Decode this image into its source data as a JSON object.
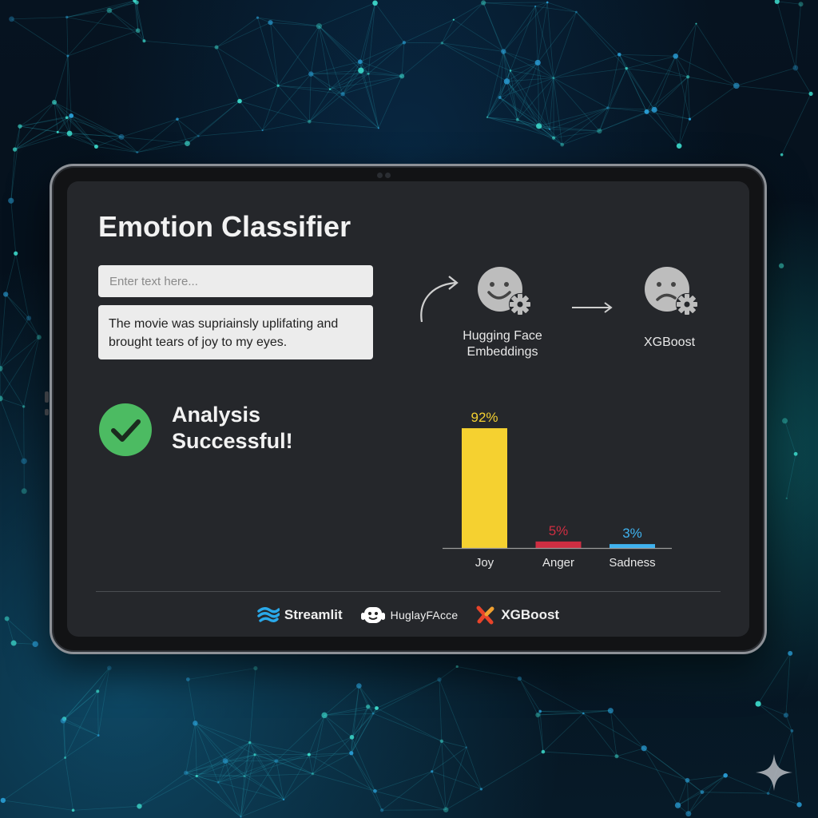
{
  "app": {
    "title": "Emotion Classifier"
  },
  "input": {
    "placeholder": "Enter text here...",
    "text": "The movie was supriainsly uplifating and brought tears of joy to my eyes."
  },
  "status": {
    "text": "Analysis Successful!",
    "icon": "check-circle-icon",
    "color": "#4cbb62"
  },
  "pipeline": {
    "steps": [
      {
        "label": "Hugging Face Embeddings",
        "icon": "smiley-gear-icon"
      },
      {
        "label": "XGBoost",
        "icon": "sad-face-gear-icon"
      }
    ]
  },
  "chart_data": {
    "type": "bar",
    "categories": [
      "Joy",
      "Anger",
      "Sadness"
    ],
    "values": [
      92,
      5,
      3
    ],
    "value_labels": [
      "92%",
      "5%",
      "3%"
    ],
    "colors": [
      "#f5d130",
      "#cf2e42",
      "#3fb3f0"
    ],
    "ylim": [
      0,
      100
    ],
    "title": "",
    "xlabel": "",
    "ylabel": "",
    "grid": false
  },
  "footer": {
    "brands": [
      {
        "name": "Streamlit",
        "icon": "streamlit-logo-icon",
        "color": "#2aa9ea"
      },
      {
        "name": "HuglayFAcce",
        "icon": "hugging-face-logo-icon",
        "color": "#ffffff"
      },
      {
        "name": "XGBoost",
        "icon": "xgboost-logo-icon",
        "color": "#e8442a"
      }
    ]
  },
  "colors": {
    "screen_bg": "#25272b",
    "input_bg": "#ececec",
    "text_primary": "#f2f2f2"
  }
}
